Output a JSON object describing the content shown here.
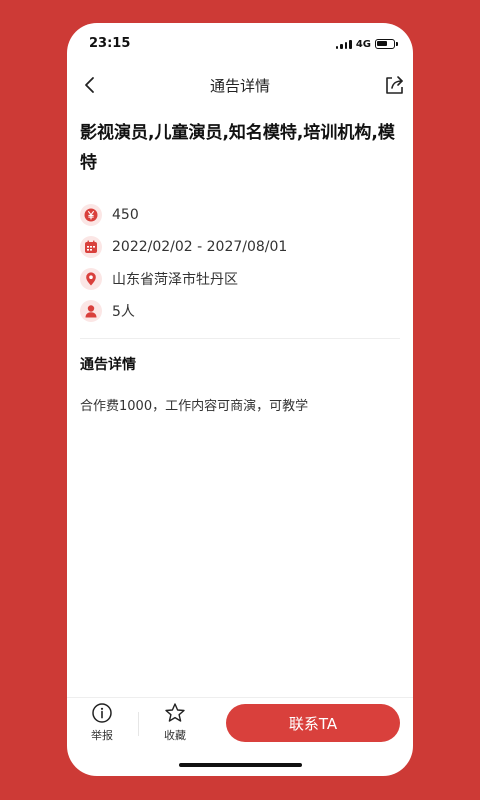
{
  "status_bar": {
    "time": "23:15",
    "network": "4G"
  },
  "nav": {
    "title": "通告详情"
  },
  "headline": "影视演员,儿童演员,知名模特,培训机构,模特",
  "info": {
    "price": "450",
    "date_range": "2022/02/02 - 2027/08/01",
    "location": "山东省菏泽市牡丹区",
    "headcount": "5人"
  },
  "detail": {
    "title": "通告详情",
    "body": "合作费1000，工作内容可商演，可教学"
  },
  "bottom_bar": {
    "report_label": "举报",
    "favorite_label": "收藏",
    "contact_label": "联系TA"
  },
  "icons": {
    "back": "chevron-left-icon",
    "share": "share-icon",
    "price": "yen-icon",
    "date": "calendar-icon",
    "location": "location-pin-icon",
    "headcount": "person-icon",
    "report": "info-circle-icon",
    "favorite": "star-outline-icon"
  },
  "colors": {
    "background": "#cd3a36",
    "accent": "#d9403c",
    "icon_bg": "#fbe6e5"
  }
}
